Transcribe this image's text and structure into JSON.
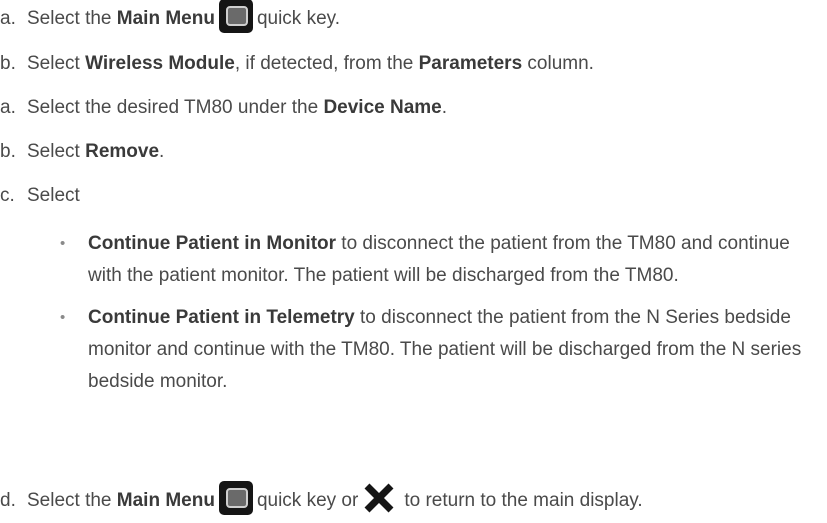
{
  "steps": [
    {
      "marker": "a.",
      "pre": "Select the ",
      "b1": "Main Menu",
      "post": "quick key."
    },
    {
      "marker": "b.",
      "pre": "Select ",
      "b1": "Wireless Module",
      "mid": ", if detected, from the ",
      "b2": "Parameters",
      "post": " column."
    },
    {
      "marker": "a.",
      "pre": "Select the desired TM80 under the ",
      "b1": "Device Name",
      "post": "."
    },
    {
      "marker": "b.",
      "pre": "Select ",
      "b1": "Remove",
      "post": "."
    },
    {
      "marker": "c.",
      "pre": "Select"
    }
  ],
  "bullets": [
    {
      "bold": "Continue Patient in Monitor",
      "text": " to disconnect the patient from the TM80 and continue with the patient monitor. The patient will be discharged from the TM80."
    },
    {
      "bold": "Continue Patient in Telemetry",
      "text": " to disconnect the patient from the N Series bedside monitor and continue with the TM80.  The patient will be discharged from the N series bedside monitor."
    }
  ],
  "final": {
    "marker": "d.",
    "pre": "Select the ",
    "b1": "Main Menu",
    "mid": "quick key or",
    "post": "to return to the main display."
  },
  "icons": {
    "main_menu": "main-menu-icon",
    "close": "close-x-icon"
  },
  "colors": {
    "text": "#4a4a4a",
    "icon_bg": "#151515"
  }
}
